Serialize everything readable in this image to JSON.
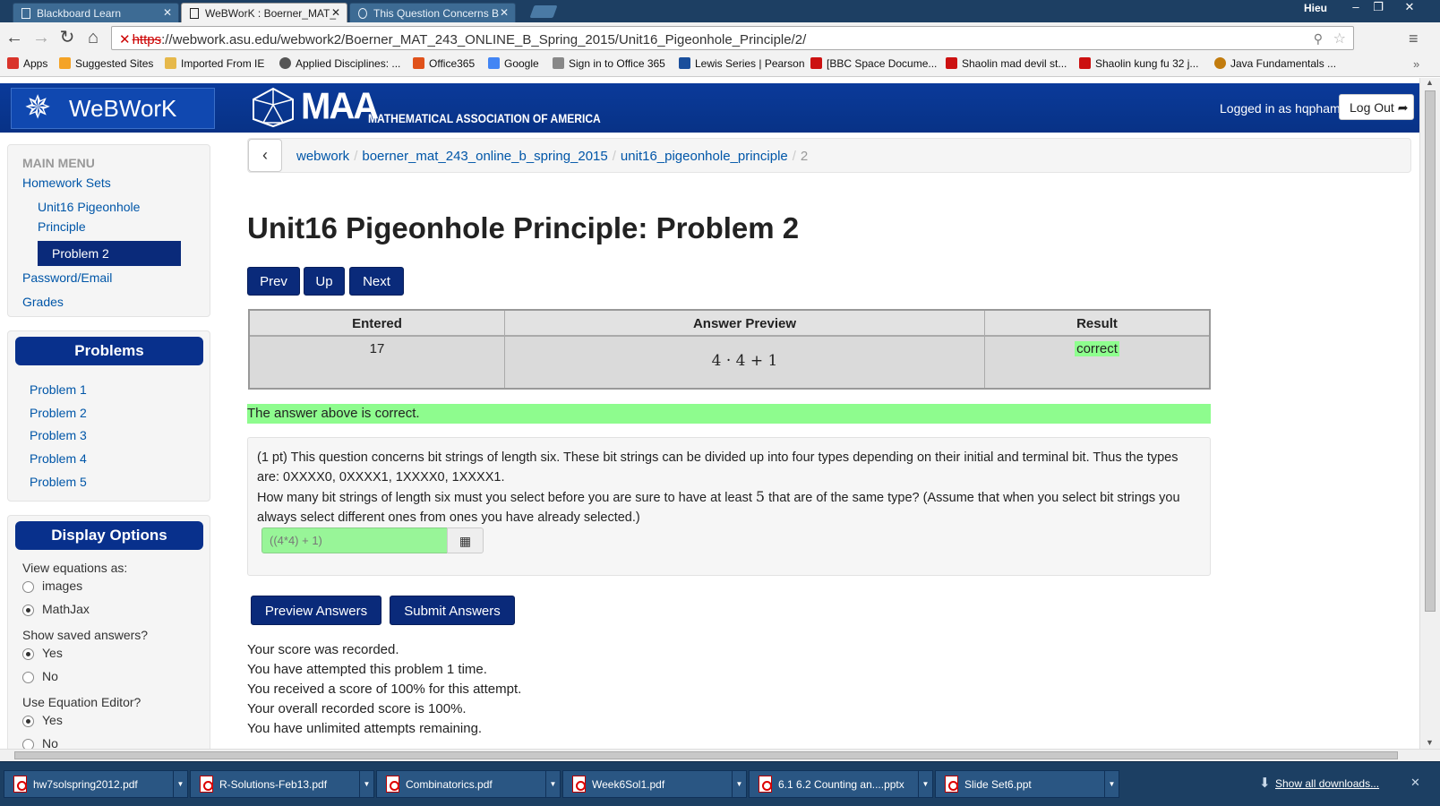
{
  "browser": {
    "tabs": [
      {
        "label": "Blackboard Learn",
        "active": false
      },
      {
        "label": "WeBWorK : Boerner_MAT_",
        "active": true
      },
      {
        "label": "This Question Concerns B",
        "active": false
      }
    ],
    "user": "Hieu",
    "url_scheme": "https",
    "url_rest": "://webwork.asu.edu/webwork2/Boerner_MAT_243_ONLINE_B_Spring_2015/Unit16_Pigeonhole_Principle/2/",
    "bookmarks": [
      {
        "label": "Apps",
        "icon_color": "#d9342b"
      },
      {
        "label": "Suggested Sites",
        "icon_color": "#f4a326"
      },
      {
        "label": "Imported From IE",
        "icon_color": "#e6b84a"
      },
      {
        "label": "Applied Disciplines: ...",
        "icon_color": "#555555"
      },
      {
        "label": "Office365",
        "icon_color": "#e0521b"
      },
      {
        "label": "Google",
        "icon_color": "#4285f4"
      },
      {
        "label": "Sign in to Office 365",
        "icon_color": "#888888"
      },
      {
        "label": "Lewis Series | Pearson",
        "icon_color": "#1a4f9c"
      },
      {
        "label": "[BBC Space Docume...",
        "icon_color": "#cc1111"
      },
      {
        "label": "Shaolin mad devil st...",
        "icon_color": "#cc1111"
      },
      {
        "label": "Shaolin kung fu 32 j...",
        "icon_color": "#cc1111"
      },
      {
        "label": "Java Fundamentals ...",
        "icon_color": "#c27c0e"
      }
    ]
  },
  "header": {
    "app_name": "WeBWorK",
    "maa_short": "MAA",
    "maa_full": "MATHEMATICAL ASSOCIATION OF AMERICA",
    "logged_in_text": "Logged in as hqpham.",
    "logout_label": "Log Out"
  },
  "sidebar": {
    "main_menu_title": "MAIN MENU",
    "homework_sets": "Homework Sets",
    "set_name_line1": "Unit16 Pigeonhole",
    "set_name_line2": "Principle",
    "current_problem": "Problem 2",
    "password_email": "Password/Email",
    "grades": "Grades",
    "problems_title": "Problems",
    "problems": [
      "Problem 1",
      "Problem 2",
      "Problem 3",
      "Problem 4",
      "Problem 5"
    ],
    "display_options_title": "Display Options",
    "view_equations_label": "View equations as:",
    "view_images": "images",
    "view_mathjax": "MathJax",
    "show_saved_label": "Show saved answers?",
    "yes": "Yes",
    "no": "No",
    "use_editor_label": "Use Equation Editor?"
  },
  "breadcrumb": {
    "items": [
      "webwork",
      "boerner_mat_243_online_b_spring_2015",
      "unit16_pigeonhole_principle"
    ],
    "current": "2"
  },
  "main": {
    "title": "Unit16 Pigeonhole Principle: Problem 2",
    "prev": "Prev",
    "up": "Up",
    "next": "Next",
    "table": {
      "headers": [
        "Entered",
        "Answer Preview",
        "Result"
      ],
      "entered": "17",
      "preview": "4 · 4 + 1",
      "result": "correct"
    },
    "correct_banner": "The answer above is correct.",
    "problem_text_1": "(1 pt) This question concerns bit strings of length six. These bit strings can be divided up into four types depending on their initial and terminal bit. Thus the types are: 0XXXX0, 0XXXX1, 1XXXX0, 1XXXX1.",
    "problem_text_2a": "How many bit strings of length six must you select before you are sure to have at least ",
    "problem_k": "5",
    "problem_text_2b": " that are of the same type? (Assume that when you select bit strings you always select different ones from ones you have already selected.)",
    "answer_value": "((4*4) + 1)",
    "preview_button": "Preview Answers",
    "submit_button": "Submit Answers",
    "score_lines": [
      "Your score was recorded.",
      "You have attempted this problem 1 time.",
      "You received a score of 100% for this attempt.",
      "Your overall recorded score is 100%.",
      "You have unlimited attempts remaining."
    ]
  },
  "downloads": {
    "files": [
      "hw7solspring2012.pdf",
      "R-Solutions-Feb13.pdf",
      "Combinatorics.pdf",
      "Week6Sol1.pdf",
      "6.1 6.2 Counting an....pptx",
      "Slide Set6.ppt"
    ],
    "show_all": "Show all downloads..."
  }
}
